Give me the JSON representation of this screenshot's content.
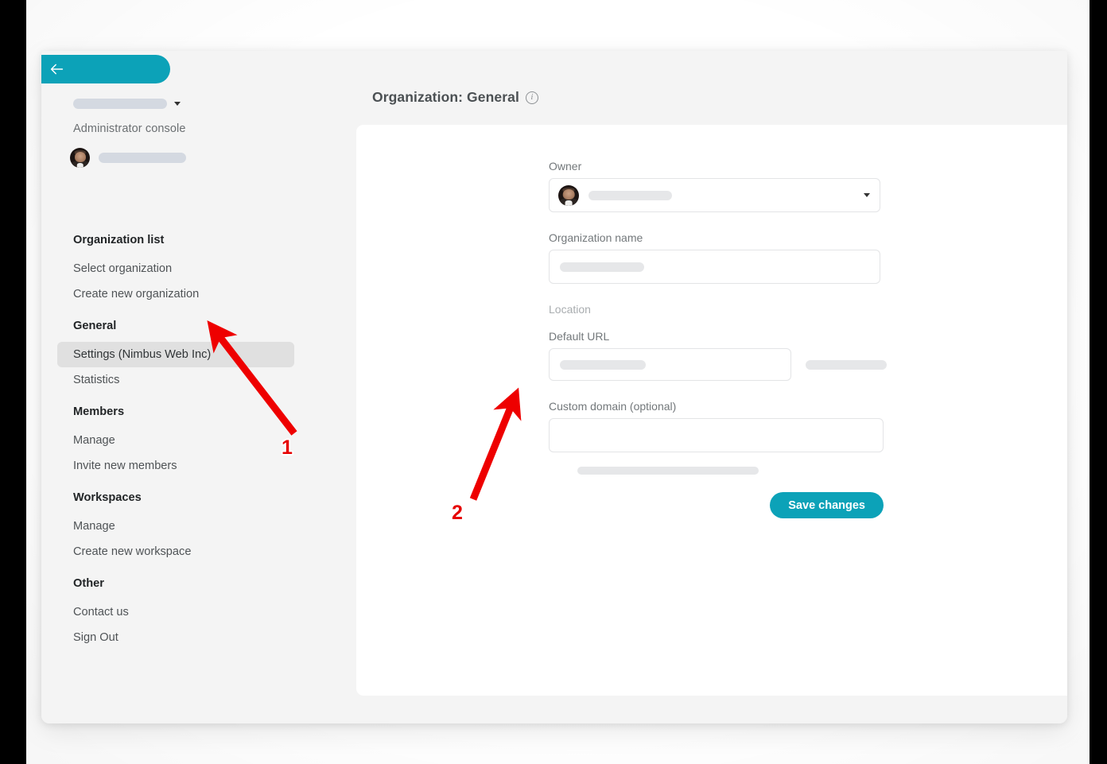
{
  "sidebar": {
    "back_button": {
      "icon": "arrow-left-icon"
    },
    "org_switcher": {
      "icon": "chevron-down-icon",
      "value_redacted": true
    },
    "admin_console_label": "Administrator console",
    "user_row": {
      "avatar": "user-avatar",
      "name_redacted": true
    },
    "groups": [
      {
        "title": "Organization list",
        "items": [
          {
            "label": "Select organization",
            "active": false
          },
          {
            "label": "Create new organization",
            "active": false
          }
        ]
      },
      {
        "title": "General",
        "items": [
          {
            "label": "Settings (Nimbus Web Inc)",
            "active": true
          },
          {
            "label": "Statistics",
            "active": false
          }
        ]
      },
      {
        "title": "Members",
        "items": [
          {
            "label": "Manage",
            "active": false
          },
          {
            "label": "Invite new members",
            "active": false
          }
        ]
      },
      {
        "title": "Workspaces",
        "items": [
          {
            "label": "Manage",
            "active": false
          },
          {
            "label": "Create new workspace",
            "active": false
          }
        ]
      },
      {
        "title": "Other",
        "items": [
          {
            "label": "Contact us",
            "active": false
          },
          {
            "label": "Sign Out",
            "active": false
          }
        ]
      }
    ]
  },
  "main": {
    "page_title": "Organization: General",
    "info_icon": "info-icon",
    "info_glyph": "i",
    "form": {
      "owner_label": "Owner",
      "owner_value_redacted": true,
      "owner_avatar": "user-avatar",
      "owner_caret": "caret-down-icon",
      "org_name_label": "Organization name",
      "org_name_value_redacted": true,
      "location_label": "Location",
      "default_url_label": "Default URL",
      "default_url_value_redacted": true,
      "url_suffix_redacted": true,
      "custom_domain_label": "Custom domain (optional)",
      "custom_domain_value": "",
      "custom_domain_placeholder": "",
      "hint_redacted": true,
      "save_label": "Save changes"
    }
  },
  "annotations": {
    "accent_color": "#e60000",
    "markers": [
      {
        "label": "1",
        "target": "sidebar-item-settings"
      },
      {
        "label": "2",
        "target": "custom-domain-input"
      }
    ]
  },
  "theme": {
    "accent": "#0ca2b8",
    "window_bg": "#f4f4f4",
    "card_bg": "#ffffff",
    "active_item_bg": "#e0e0e0"
  }
}
